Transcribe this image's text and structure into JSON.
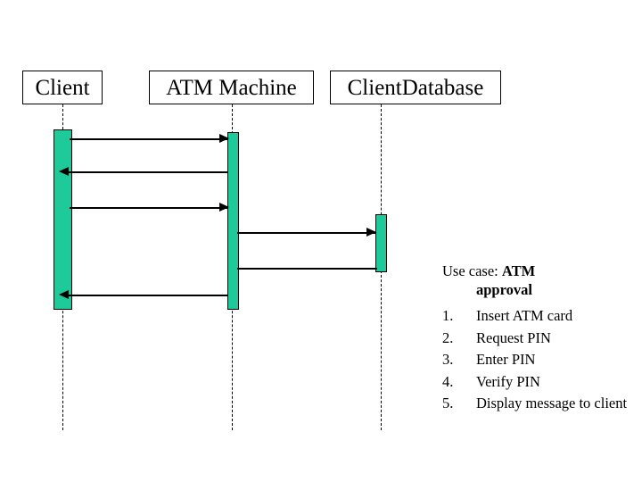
{
  "diagram": {
    "type": "uml-sequence-diagram",
    "background_color": "#ffffff",
    "line_color": "#000000",
    "activation_color": "#1ec99a",
    "participants": [
      {
        "id": "client",
        "name": "Client"
      },
      {
        "id": "atm",
        "name": "ATM Machine"
      },
      {
        "id": "database",
        "name": "ClientDatabase"
      }
    ],
    "messages": [
      {
        "seq": 1,
        "from": "client",
        "to": "atm",
        "direction": "right",
        "arrowhead": true
      },
      {
        "seq": 2,
        "from": "atm",
        "to": "client",
        "direction": "left",
        "arrowhead": true
      },
      {
        "seq": 3,
        "from": "client",
        "to": "atm",
        "direction": "right",
        "arrowhead": true
      },
      {
        "seq": 4,
        "from": "atm",
        "to": "database",
        "direction": "right",
        "arrowhead": true
      },
      {
        "seq": 5,
        "from": "database",
        "to": "atm",
        "direction": "left",
        "arrowhead": false
      },
      {
        "seq": 6,
        "from": "atm",
        "to": "client",
        "direction": "left",
        "arrowhead": true
      }
    ]
  },
  "legend": {
    "title_lead": "Use case:",
    "title_emphasis": "ATM",
    "title_line2": "approval",
    "steps": [
      {
        "number": "1.",
        "text": "Insert ATM card"
      },
      {
        "number": "2.",
        "text": "Request PIN"
      },
      {
        "number": "3.",
        "text": "Enter PIN"
      },
      {
        "number": "4.",
        "text": "Verify PIN"
      },
      {
        "number": "5.",
        "text": "Display message to client"
      }
    ]
  }
}
